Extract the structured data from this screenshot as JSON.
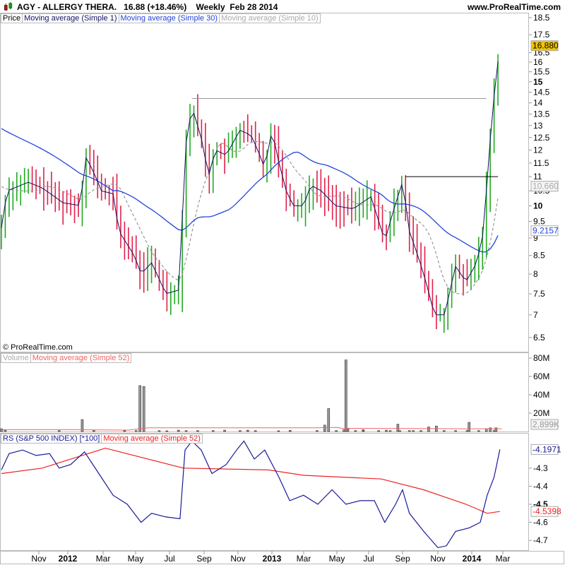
{
  "header": {
    "title": "AGY - ALLERGY THERA.",
    "price": "16.88 (+18.46%)",
    "period": "Weekly",
    "date": "Feb 28 2014",
    "site": "www.ProRealTime.com"
  },
  "price_legend": [
    "Price",
    "Moving average (Simple 1)",
    "Moving average (Simple 30)",
    "Moving average (Simple 10)"
  ],
  "copyright": "© ProRealTime.com",
  "volume_legend": [
    "Volume",
    "Moving average (Simple 52)"
  ],
  "rs_legend": [
    "RS (S&P 500 INDEX) [*100]",
    "Moving average (Simple 52)"
  ],
  "colors": {
    "up": "#22aa22",
    "down": "#e0204a",
    "ma30": "#2244dd",
    "ma1": "#111166",
    "ma10": "#999999",
    "rs": "#1a1a99",
    "rsma": "#ee2222",
    "last": "#f2c400"
  },
  "chart_data": [
    {
      "type": "candlestick",
      "title": "AGY Price (Weekly)",
      "yscale": "log",
      "ylim": [
        6.3,
        18.7
      ],
      "yticks": [
        "18.5",
        "17.5",
        "16.5",
        "16",
        "15.5",
        "15",
        "14.5",
        "14",
        "13.5",
        "13",
        "12.5",
        "12",
        "11.5",
        "11",
        "10.5",
        "10",
        "9.5",
        "9",
        "8.5",
        "8",
        "7.5",
        "7",
        "6.5"
      ],
      "xticks": [
        "Nov",
        "2012",
        "Mar",
        "May",
        "Jul",
        "Sep",
        "Nov",
        "2013",
        "Mar",
        "May",
        "Jul",
        "Sep",
        "Nov",
        "2014",
        "Mar"
      ],
      "close_keypoints": [
        [
          0,
          9.3
        ],
        [
          1.5,
          10.5
        ],
        [
          7,
          10.8
        ],
        [
          10.6,
          10.6
        ],
        [
          16,
          10.1
        ],
        [
          20.7,
          10.0
        ],
        [
          21.6,
          11.8
        ],
        [
          23.5,
          11.3
        ],
        [
          26,
          10.5
        ],
        [
          29,
          10.4
        ],
        [
          30.5,
          9.2
        ],
        [
          34.5,
          8.5
        ],
        [
          36.3,
          8.0
        ],
        [
          39,
          8.3
        ],
        [
          42.7,
          7.5
        ],
        [
          46.4,
          7.6
        ],
        [
          47.7,
          12.0
        ],
        [
          49.5,
          13.8
        ],
        [
          51.9,
          12.5
        ],
        [
          53.8,
          11.0
        ],
        [
          55.6,
          12.0
        ],
        [
          58.4,
          11.8
        ],
        [
          62,
          12.8
        ],
        [
          64.8,
          12.6
        ],
        [
          66.6,
          12.0
        ],
        [
          68.4,
          11.3
        ],
        [
          70.3,
          12.8
        ],
        [
          72.1,
          11.5
        ],
        [
          74,
          10.5
        ],
        [
          75.8,
          10.0
        ],
        [
          78.5,
          10.0
        ],
        [
          80.4,
          10.7
        ],
        [
          83.1,
          10.5
        ],
        [
          86.8,
          10.0
        ],
        [
          91.4,
          9.9
        ],
        [
          96,
          10.3
        ],
        [
          99.6,
          8.9
        ],
        [
          101.5,
          9.7
        ],
        [
          104.2,
          10.8
        ],
        [
          106,
          9.2
        ],
        [
          109.7,
          8.0
        ],
        [
          112.5,
          7.0
        ],
        [
          115.2,
          7.0
        ],
        [
          118,
          8.2
        ],
        [
          120.7,
          7.8
        ],
        [
          123.5,
          8.3
        ],
        [
          125.3,
          9.2
        ],
        [
          126.8,
          12.0
        ],
        [
          128.1,
          14.5
        ],
        [
          129.5,
          16.88
        ]
      ],
      "last": "16.880",
      "ma10_last": "10.660",
      "ma30_last": "9.2157",
      "resistance_lines": [
        {
          "value": 14.2,
          "from_week": 49.5,
          "to_week": 126
        },
        {
          "value": 11.0,
          "from_week": 105,
          "to_week": 129
        }
      ]
    },
    {
      "type": "bar",
      "title": "Volume",
      "ylim": [
        0,
        85
      ],
      "unit": "M",
      "yticks": [
        "80M",
        "60M",
        "40M",
        "20M"
      ],
      "last": "2,899K",
      "volumes": [
        [
          0,
          3
        ],
        [
          1,
          1.5
        ],
        [
          15,
          1
        ],
        [
          24,
          1
        ],
        [
          21,
          13
        ],
        [
          32,
          1
        ],
        [
          35,
          1
        ],
        [
          41,
          1
        ],
        [
          43,
          0.8
        ],
        [
          46,
          1.5
        ],
        [
          48,
          1
        ],
        [
          51,
          1
        ],
        [
          55,
          1
        ],
        [
          58,
          1.5
        ],
        [
          62,
          1
        ],
        [
          64,
          1.5
        ],
        [
          66,
          1
        ],
        [
          72,
          0.8
        ],
        [
          75,
          1.3
        ],
        [
          82,
          1
        ],
        [
          84,
          7
        ],
        [
          87,
          1
        ],
        [
          89,
          2
        ],
        [
          90,
          3
        ],
        [
          92,
          1
        ],
        [
          94,
          2
        ],
        [
          98,
          1
        ],
        [
          100,
          1.5
        ],
        [
          101,
          1
        ],
        [
          103,
          8
        ],
        [
          107,
          1
        ],
        [
          109,
          1
        ],
        [
          111,
          5
        ],
        [
          113,
          6
        ],
        [
          118,
          1
        ],
        [
          121,
          1
        ],
        [
          128,
          1
        ],
        [
          36,
          50
        ],
        [
          37,
          49
        ],
        [
          85,
          25
        ],
        [
          89.5,
          78
        ],
        [
          94,
          1
        ],
        [
          103.5,
          1
        ],
        [
          106,
          1
        ],
        [
          115,
          1
        ],
        [
          121.5,
          10
        ],
        [
          124,
          1
        ],
        [
          126,
          3
        ],
        [
          127,
          4
        ],
        [
          128.5,
          4
        ]
      ],
      "ma52": [
        [
          0,
          2
        ],
        [
          18,
          2
        ],
        [
          33,
          1.5
        ],
        [
          38,
          4
        ],
        [
          82,
          4
        ],
        [
          87,
          4.5
        ],
        [
          88.5,
          3.5
        ],
        [
          120,
          3
        ],
        [
          130,
          3
        ]
      ]
    },
    {
      "type": "line",
      "title": "RS (S&P 500 INDEX) [*100]",
      "ylim": [
        -4.75,
        -4.15
      ],
      "yticks": [
        "-4.3",
        "-4.4",
        "-4.5",
        "-4.6",
        "-4.7"
      ],
      "last": "-4.1971",
      "ma_last": "-4.5398",
      "rs": [
        [
          0,
          -4.31
        ],
        [
          2,
          -4.22
        ],
        [
          5.5,
          -4.2
        ],
        [
          9,
          -4.23
        ],
        [
          12.5,
          -4.22
        ],
        [
          15,
          -4.3
        ],
        [
          18,
          -4.28
        ],
        [
          21.6,
          -4.21
        ],
        [
          25.3,
          -4.33
        ],
        [
          29,
          -4.45
        ],
        [
          32.7,
          -4.5
        ],
        [
          36.3,
          -4.6
        ],
        [
          39,
          -4.55
        ],
        [
          42.7,
          -4.57
        ],
        [
          46.4,
          -4.58
        ],
        [
          47.7,
          -4.2
        ],
        [
          49.5,
          -4.15
        ],
        [
          51.9,
          -4.2
        ],
        [
          54.7,
          -4.33
        ],
        [
          58.4,
          -4.28
        ],
        [
          61.1,
          -4.2
        ],
        [
          63,
          -4.15
        ],
        [
          65.7,
          -4.25
        ],
        [
          68.4,
          -4.2
        ],
        [
          72.1,
          -4.35
        ],
        [
          74.9,
          -4.48
        ],
        [
          78.5,
          -4.45
        ],
        [
          82.2,
          -4.5
        ],
        [
          85.9,
          -4.42
        ],
        [
          89.5,
          -4.5
        ],
        [
          93.2,
          -4.48
        ],
        [
          96.9,
          -4.48
        ],
        [
          99.6,
          -4.6
        ],
        [
          102.4,
          -4.5
        ],
        [
          104.2,
          -4.42
        ],
        [
          106,
          -4.55
        ],
        [
          109.7,
          -4.65
        ],
        [
          113.4,
          -4.74
        ],
        [
          115.6,
          -4.73
        ],
        [
          118,
          -4.65
        ],
        [
          121.6,
          -4.63
        ],
        [
          124.4,
          -4.6
        ],
        [
          126.2,
          -4.45
        ],
        [
          128,
          -4.35
        ],
        [
          129.5,
          -4.197
        ]
      ],
      "ma52": [
        [
          0,
          -4.33
        ],
        [
          10.6,
          -4.3
        ],
        [
          27,
          -4.19
        ],
        [
          47.3,
          -4.3
        ],
        [
          69.4,
          -4.31
        ],
        [
          78.5,
          -4.34
        ],
        [
          98.7,
          -4.36
        ],
        [
          109.7,
          -4.42
        ],
        [
          120.7,
          -4.5
        ],
        [
          126.2,
          -4.55
        ],
        [
          129.5,
          -4.54
        ]
      ]
    }
  ]
}
